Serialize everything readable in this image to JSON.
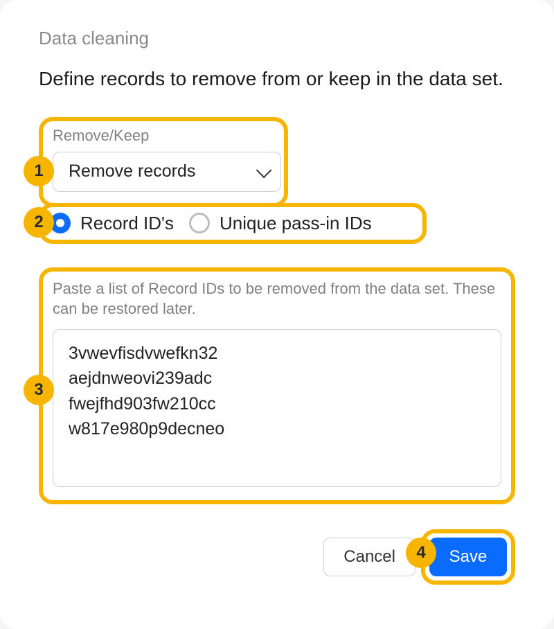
{
  "section_title": "Data cleaning",
  "description": "Define records to remove from or keep in the data set.",
  "step1": {
    "badge": "1",
    "label": "Remove/Keep",
    "selected": "Remove records"
  },
  "step2": {
    "badge": "2",
    "option_a": "Record ID's",
    "option_b": "Unique pass-in IDs"
  },
  "step3": {
    "badge": "3",
    "help": "Paste a list of Record IDs to be removed from the data set. These can be restored later.",
    "value": "3vwevfisdvwefkn32\naejdnweovi239adc\nfwejfhd903fw210cc\nw817e980p9decneo"
  },
  "step4": {
    "badge": "4"
  },
  "buttons": {
    "cancel": "Cancel",
    "save": "Save"
  }
}
